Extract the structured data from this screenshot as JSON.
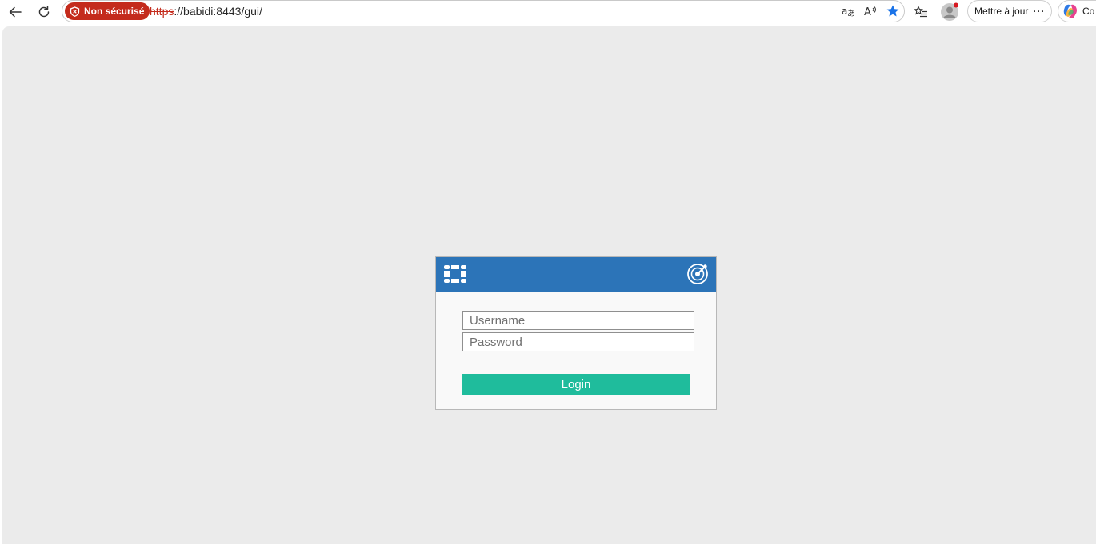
{
  "browser": {
    "security_badge": "Non sécurisé",
    "url_scheme": "https",
    "url_rest": "://babidi:8443/gui/",
    "update_button": "Mettre à jour",
    "update_more": "···",
    "copilot_label": "Co",
    "icons": {
      "back": "back-arrow-icon",
      "refresh": "refresh-icon",
      "translate": "translate-icon",
      "read_aloud": "read-aloud-icon",
      "favorite": "star-icon",
      "favorites": "favorites-list-icon",
      "profile": "profile-avatar-icon"
    },
    "colors": {
      "security_red": "#c42b1c",
      "star_blue": "#1a73e8"
    }
  },
  "login": {
    "username_placeholder": "Username",
    "password_placeholder": "Password",
    "login_button": "Login",
    "colors": {
      "header": "#2c74b8",
      "button": "#1fbc9c",
      "background": "#ebebeb"
    }
  }
}
